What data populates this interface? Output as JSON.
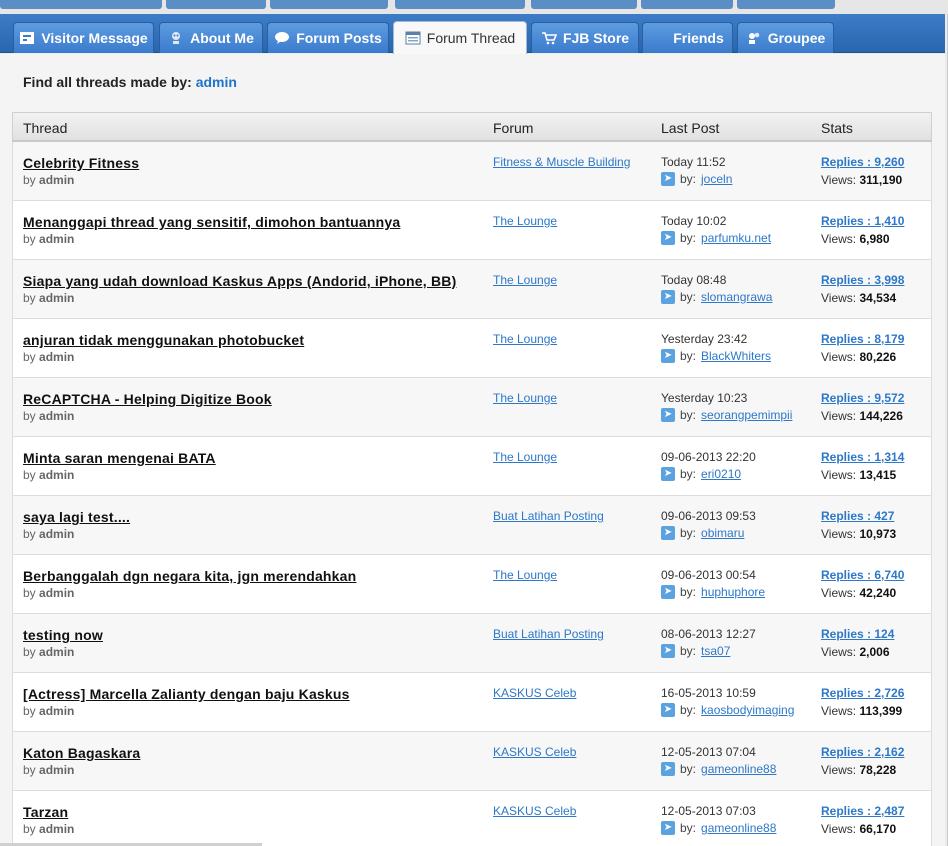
{
  "tabs": [
    {
      "label": "Visitor Message",
      "icon": "message-icon"
    },
    {
      "label": "About Me",
      "icon": "profile-icon"
    },
    {
      "label": "Forum Posts",
      "icon": "speech-bubble-icon"
    },
    {
      "label": "Forum Thread",
      "icon": "thread-list-icon"
    },
    {
      "label": "FJB Store",
      "icon": "cart-icon"
    },
    {
      "label": "Friends",
      "icon": "friends-icon"
    },
    {
      "label": "Groupee",
      "icon": "group-icon"
    }
  ],
  "active_tab": "Forum Thread",
  "find": {
    "prefix": "Find all threads made by:",
    "user": "admin"
  },
  "columns": {
    "thread": "Thread",
    "forum": "Forum",
    "last_post": "Last Post",
    "stats": "Stats"
  },
  "rows": [
    {
      "title": "Celebrity Fitness",
      "by_prefix": "by",
      "by": "admin",
      "forum": "Fitness & Muscle Building",
      "date": "Today 11:52",
      "last_prefix": "by:",
      "last_by": "joceln",
      "replies": "Replies : 9,260",
      "views_label": "Views:",
      "views": "311,190"
    },
    {
      "title": "Menanggapi thread yang sensitif, dimohon bantuannya",
      "by_prefix": "by",
      "by": "admin",
      "forum": "The Lounge",
      "date": "Today 10:02",
      "last_prefix": "by:",
      "last_by": "parfumku.net",
      "replies": "Replies : 1,410",
      "views_label": "Views:",
      "views": "6,980"
    },
    {
      "title": "Siapa yang udah download Kaskus Apps (Andorid, iPhone, BB)",
      "by_prefix": "by",
      "by": "admin",
      "forum": "The Lounge",
      "date": "Today 08:48",
      "last_prefix": "by:",
      "last_by": "slomangrawa",
      "replies": "Replies : 3,998",
      "views_label": "Views:",
      "views": "34,534"
    },
    {
      "title": "anjuran tidak menggunakan photobucket",
      "by_prefix": "by",
      "by": "admin",
      "forum": "The Lounge",
      "date": "Yesterday 23:42",
      "last_prefix": "by:",
      "last_by": "BlackWhiters",
      "replies": "Replies : 8,179",
      "views_label": "Views:",
      "views": "80,226"
    },
    {
      "title": "ReCAPTCHA - Helping Digitize Book",
      "by_prefix": "by",
      "by": "admin",
      "forum": "The Lounge",
      "date": "Yesterday 10:23",
      "last_prefix": "by:",
      "last_by": "seorangpemimpii",
      "replies": "Replies : 9,572",
      "views_label": "Views:",
      "views": "144,226"
    },
    {
      "title": "Minta saran mengenai BATA",
      "by_prefix": "by",
      "by": "admin",
      "forum": "The Lounge",
      "date": "09-06-2013 22:20",
      "last_prefix": "by:",
      "last_by": "eri0210",
      "replies": "Replies : 1,314",
      "views_label": "Views:",
      "views": "13,415"
    },
    {
      "title": "saya lagi test....",
      "by_prefix": "by",
      "by": "admin",
      "forum": "Buat Latihan Posting",
      "date": "09-06-2013 09:53",
      "last_prefix": "by:",
      "last_by": "obimaru",
      "replies": "Replies : 427",
      "views_label": "Views:",
      "views": "10,973"
    },
    {
      "title": "Berbanggalah dgn negara kita, jgn merendahkan",
      "by_prefix": "by",
      "by": "admin",
      "forum": "The Lounge",
      "date": "09-06-2013 00:54",
      "last_prefix": "by:",
      "last_by": "huphuphore",
      "replies": "Replies : 6,740",
      "views_label": "Views:",
      "views": "42,240"
    },
    {
      "title": "testing now",
      "by_prefix": "by",
      "by": "admin",
      "forum": "Buat Latihan Posting",
      "date": "08-06-2013 12:27",
      "last_prefix": "by:",
      "last_by": "tsa07",
      "replies": "Replies : 124",
      "views_label": "Views:",
      "views": "2,006"
    },
    {
      "title": "[Actress] Marcella Zalianty dengan baju Kaskus",
      "by_prefix": "by",
      "by": "admin",
      "forum": "KASKUS Celeb",
      "date": "16-05-2013 10:59",
      "last_prefix": "by:",
      "last_by": "kaosbodyimaging",
      "replies": "Replies : 2,726",
      "views_label": "Views:",
      "views": "113,399"
    },
    {
      "title": "Katon Bagaskara",
      "by_prefix": "by",
      "by": "admin",
      "forum": "KASKUS Celeb",
      "date": "12-05-2013 07:04",
      "last_prefix": "by:",
      "last_by": "gameonline88",
      "replies": "Replies : 2,162",
      "views_label": "Views:",
      "views": "78,228"
    },
    {
      "title": "Tarzan",
      "by_prefix": "by",
      "by": "admin",
      "forum": "KASKUS Celeb",
      "date": "12-05-2013 07:03",
      "last_prefix": "by:",
      "last_by": "gameonline88",
      "replies": "Replies : 2,487",
      "views_label": "Views:",
      "views": "66,170"
    }
  ],
  "colors": {
    "tab_bg": "#3a7bcc",
    "link": "#2d78c8",
    "accent_user": "#1f74c9"
  }
}
